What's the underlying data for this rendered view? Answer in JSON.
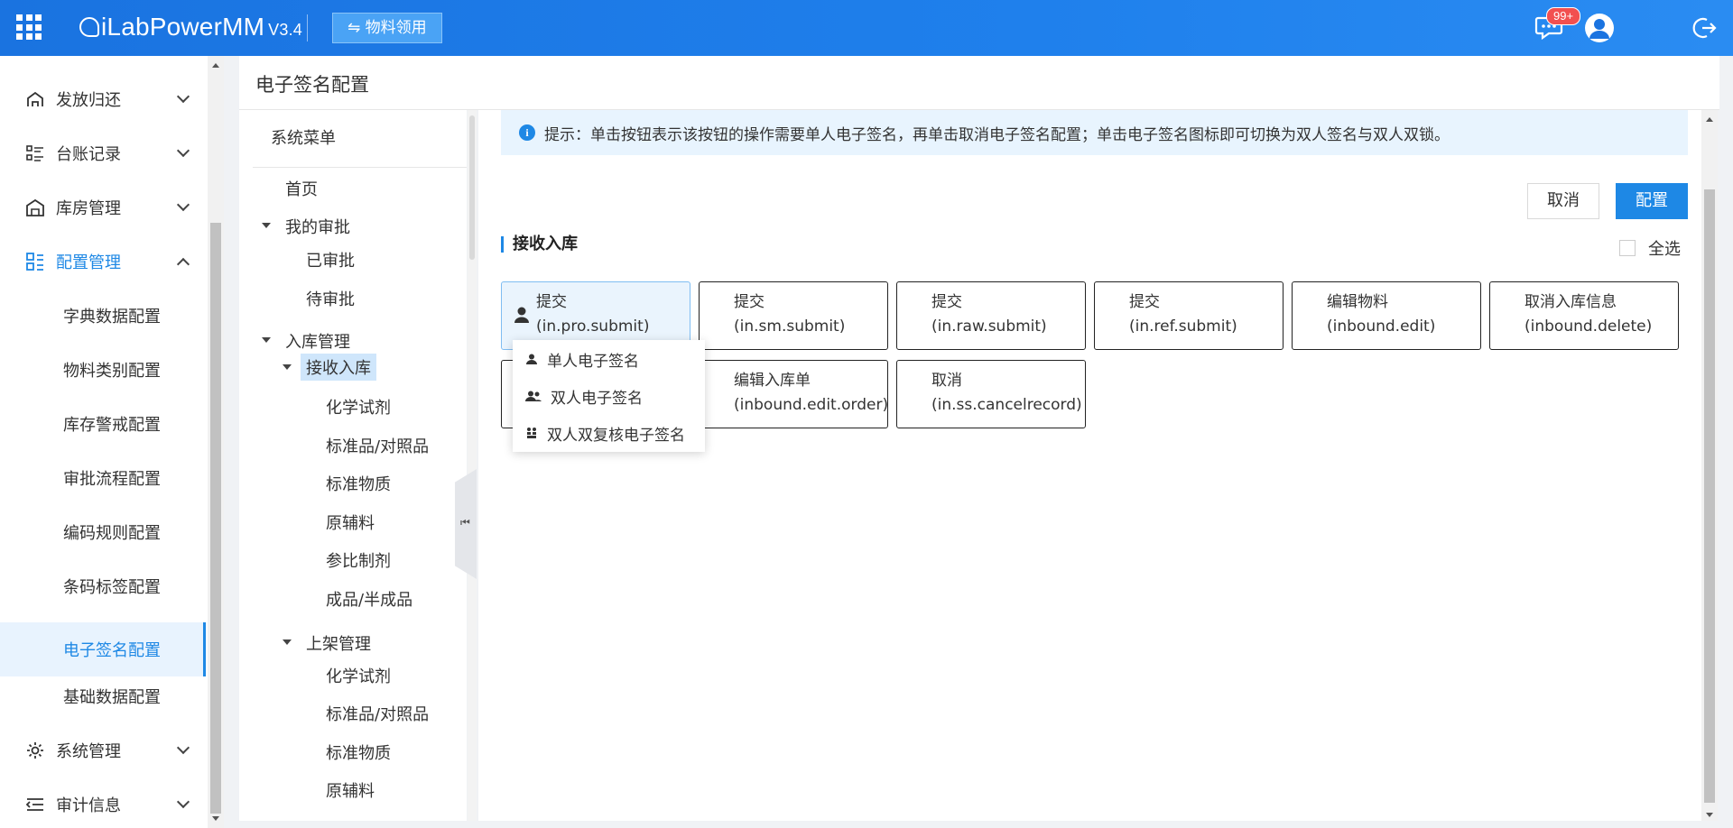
{
  "topbar": {
    "logo_text": "iLabPowerMM",
    "version": "V3.4",
    "material_button": "物料领用",
    "message_badge": "99+",
    "icons": [
      "apps-grid-icon",
      "message-icon",
      "user-avatar-icon",
      "logout-icon"
    ]
  },
  "sidebar": {
    "items": [
      {
        "label": "发放归还",
        "icon": "dispatch-icon"
      },
      {
        "label": "台账记录",
        "icon": "list-icon"
      },
      {
        "label": "库房管理",
        "icon": "warehouse-icon"
      },
      {
        "label": "配置管理",
        "icon": "config-icon"
      },
      {
        "label": "系统管理",
        "icon": "gear-icon"
      },
      {
        "label": "审计信息",
        "icon": "audit-icon"
      }
    ],
    "sub_items": [
      "字典数据配置",
      "物料类别配置",
      "库存警戒配置",
      "审批流程配置",
      "编码规则配置",
      "条码标签配置",
      "电子签名配置",
      "基础数据配置"
    ],
    "selected_sub": "电子签名配置"
  },
  "page": {
    "title": "电子签名配置"
  },
  "tree": {
    "header": "系统菜单",
    "nodes": {
      "home": "首页",
      "my_approval": "我的审批",
      "approved": "已审批",
      "pending": "待审批",
      "inbound_mgmt": "入库管理",
      "receive_inbound": "接收入库",
      "chem": "化学试剂",
      "std": "标准品/对照品",
      "std_mat": "标准物质",
      "aux": "原辅料",
      "ref_prep": "参比制剂",
      "product": "成品/半成品",
      "shelf_mgmt": "上架管理",
      "chem2": "化学试剂",
      "std2": "标准品/对照品",
      "std_mat2": "标准物质",
      "aux2": "原辅料"
    }
  },
  "main": {
    "tip": "提示：单击按钮表示该按钮的操作需要单人电子签名，再单击取消电子签名配置；单击电子签名图标即可切换为双人签名与双人双锁。",
    "cancel_button": "取消",
    "config_button": "配置",
    "section_title": "接收入库",
    "select_all": "全选",
    "cards": [
      {
        "name": "提交",
        "code": "(in.pro.submit)",
        "selected": true
      },
      {
        "name": "提交",
        "code": "(in.sm.submit)",
        "selected": false
      },
      {
        "name": "提交",
        "code": "(in.raw.submit)",
        "selected": false
      },
      {
        "name": "提交",
        "code": "(in.ref.submit)",
        "selected": false
      },
      {
        "name": "编辑物料",
        "code": "(inbound.edit)",
        "selected": false
      },
      {
        "name": "取消入库信息",
        "code": "(inbound.delete)",
        "selected": false
      },
      {
        "name": "编辑入库单",
        "code": "(inbound.edit.order)",
        "selected": false
      },
      {
        "name": "取消",
        "code": "(in.ss.cancelrecord)",
        "selected": false
      }
    ],
    "dropdown": [
      {
        "label": "单人电子签名",
        "icon": "single-user-icon"
      },
      {
        "label": "双人电子签名",
        "icon": "dual-user-icon"
      },
      {
        "label": "双人双复核电子签名",
        "icon": "dual-review-icon"
      }
    ]
  },
  "colors": {
    "primary": "#1e88e5",
    "topbar": "#1a73e0",
    "selected_bg": "#e8f3fe",
    "badge": "#f25050"
  }
}
